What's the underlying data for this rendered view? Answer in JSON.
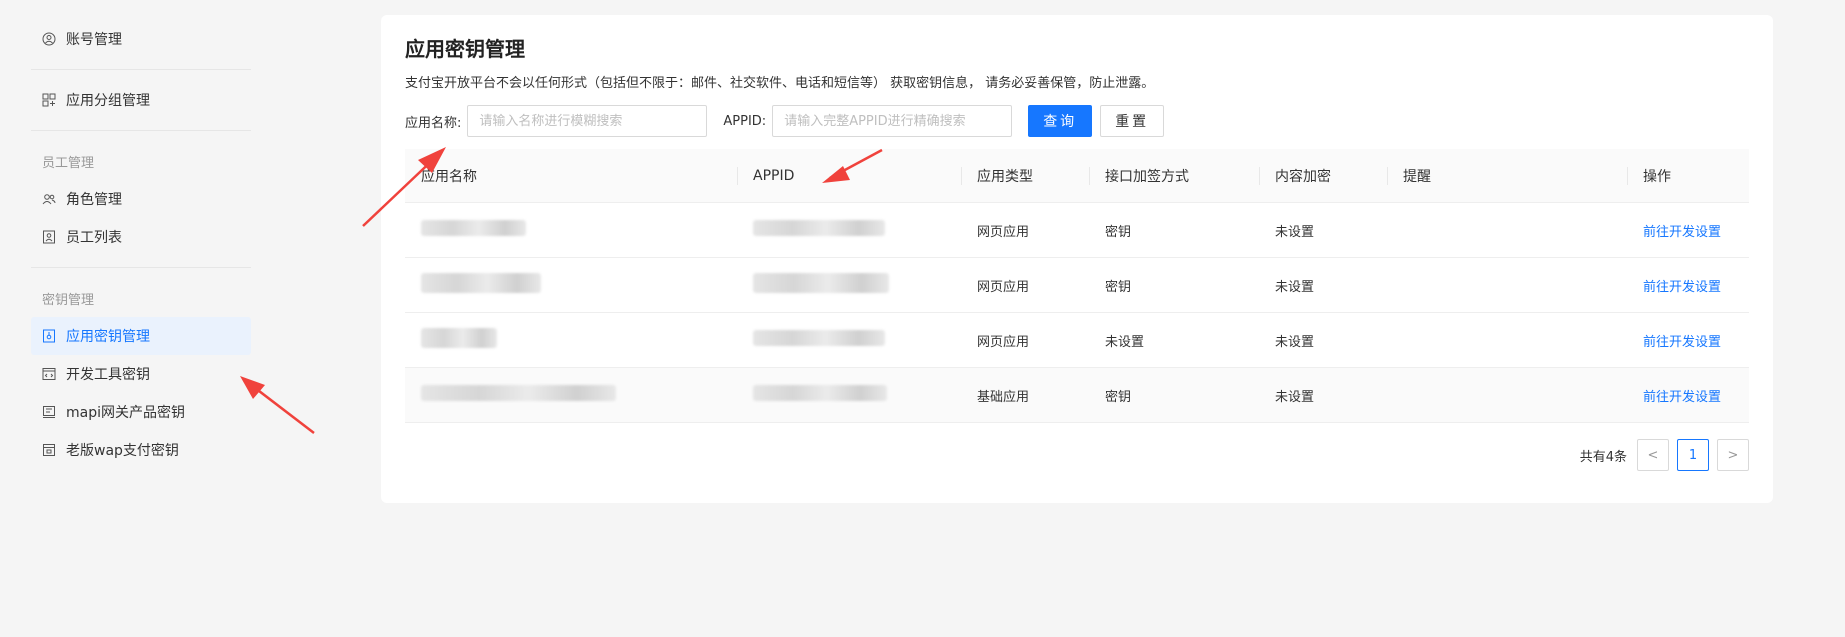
{
  "sidebar": {
    "items": [
      {
        "label": "账号管理"
      },
      {
        "label": "应用分组管理"
      },
      {
        "label": "角色管理"
      },
      {
        "label": "员工列表"
      },
      {
        "label": "应用密钥管理"
      },
      {
        "label": "开发工具密钥"
      },
      {
        "label": "mapi网关产品密钥"
      },
      {
        "label": "老版wap支付密钥"
      }
    ],
    "groups": [
      "员工管理",
      "密钥管理"
    ]
  },
  "page": {
    "title": "应用密钥管理",
    "description": "支付宝开放平台不会以任何形式（包括但不限于：邮件、社交软件、电话和短信等） 获取密钥信息， 请务必妥善保管，防止泄露。"
  },
  "filters": {
    "name_label": "应用名称:",
    "name_placeholder": "请输入名称进行模糊搜索",
    "appid_label": "APPID:",
    "appid_placeholder": "请输入完整APPID进行精确搜索",
    "search_label": "查询",
    "reset_label": "重置"
  },
  "table": {
    "headers": [
      "应用名称",
      "APPID",
      "应用类型",
      "接口加签方式",
      "内容加密",
      "提醒",
      "操作"
    ],
    "rows": [
      {
        "type": "网页应用",
        "sign": "密钥",
        "encrypt": "未设置",
        "action": "前往开发设置"
      },
      {
        "type": "网页应用",
        "sign": "密钥",
        "encrypt": "未设置",
        "action": "前往开发设置"
      },
      {
        "type": "网页应用",
        "sign": "未设置",
        "encrypt": "未设置",
        "action": "前往开发设置"
      },
      {
        "type": "基础应用",
        "sign": "密钥",
        "encrypt": "未设置",
        "action": "前往开发设置"
      }
    ]
  },
  "pagination": {
    "total": "共有4条",
    "current": "1",
    "prev": "<",
    "next": ">"
  },
  "colors": {
    "accent": "#1677ff",
    "arrow": "#f0423c"
  }
}
